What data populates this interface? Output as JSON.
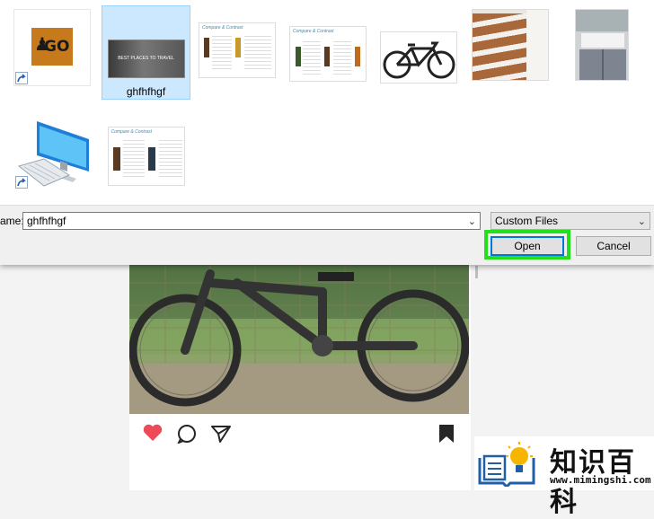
{
  "dialog": {
    "files": [
      {
        "label": "",
        "type": "game-shortcut",
        "logo_text": "GO",
        "shortcut": true
      },
      {
        "label": "ghfhfhgf",
        "type": "image",
        "caption": "BEST PLACES TO TRAVEL",
        "selected": true
      },
      {
        "label": "",
        "type": "document",
        "title": "Compare & Contrast"
      },
      {
        "label": "",
        "type": "document",
        "title": "Compare & Contrast"
      },
      {
        "label": "",
        "type": "image-bicycle"
      },
      {
        "label": "",
        "type": "image-stairs"
      },
      {
        "label": "",
        "type": "image-kitchen"
      },
      {
        "label": "",
        "type": "computer-shortcut",
        "shortcut": true
      },
      {
        "label": "",
        "type": "document",
        "title": "Compare & Contrast"
      }
    ],
    "filename_label": "ame:",
    "filename_value": "ghfhfhgf",
    "file_type_filter": "Custom Files",
    "open_button": "Open",
    "cancel_button": "Cancel",
    "highlight_color": "#22e01a"
  },
  "post": {
    "actions": [
      "heart-icon",
      "comment-icon",
      "share-icon",
      "bookmark-icon"
    ],
    "heart_color": "#ed4956"
  },
  "watermark": {
    "cn_text": "知识百科",
    "url_text": "www.mimingshi.com"
  }
}
